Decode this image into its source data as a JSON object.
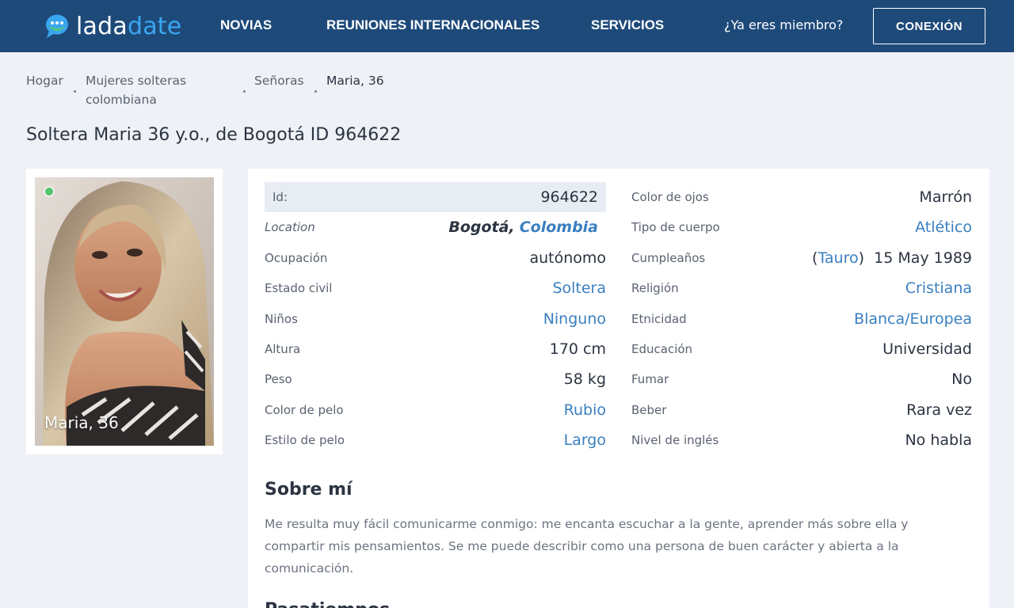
{
  "header": {
    "logo_part1": "lada",
    "logo_part2": "date",
    "nav": [
      "NOVIAS",
      "REUNIONES INTERNACIONALES",
      "SERVICIOS"
    ],
    "member_prompt": "¿Ya eres miembro?",
    "login_label": "CONEXIÓN"
  },
  "colors": {
    "header_bg": "#1e4a7a",
    "accent": "#3aa6f0",
    "link": "#3a7fbf",
    "online": "#4fc46b"
  },
  "breadcrumb": {
    "items": [
      "Hogar",
      "Mujeres solteras colombiana",
      "Señoras"
    ],
    "current": "Maria, 36"
  },
  "profile": {
    "title": "Soltera Maria 36 y.o., de Bogotá ID 964622",
    "photo_caption": "Maria, 36"
  },
  "details_left": [
    {
      "label": "Id:",
      "value": "964622"
    },
    {
      "label": "Location",
      "city": "Bogotá,",
      "country": "Colombia"
    },
    {
      "label": "Ocupación",
      "value": "autónomo"
    },
    {
      "label": "Estado civil",
      "value": "Soltera"
    },
    {
      "label": "Niños",
      "value": "Ninguno"
    },
    {
      "label": "Altura",
      "value": "170 cm"
    },
    {
      "label": "Peso",
      "value": "58 kg"
    },
    {
      "label": "Color de pelo",
      "value": "Rubio"
    },
    {
      "label": "Estilo de pelo",
      "value": "Largo"
    }
  ],
  "details_right": [
    {
      "label": "Color de ojos",
      "value": "Marrón"
    },
    {
      "label": "Tipo de cuerpo",
      "value": "Atlético"
    },
    {
      "label": "Cumpleaños",
      "zodiac": "Tauro",
      "date": "15 May 1989"
    },
    {
      "label": "Religión",
      "value": "Cristiana"
    },
    {
      "label": "Etnicidad",
      "value": "Blanca/Europea"
    },
    {
      "label": "Educación",
      "value": "Universidad"
    },
    {
      "label": "Fumar",
      "value": "No"
    },
    {
      "label": "Beber",
      "value": "Rara vez"
    },
    {
      "label": "Nivel de inglés",
      "value": "No habla"
    }
  ],
  "about": {
    "title": "Sobre mí",
    "text": "Me resulta muy fácil comunicarme conmigo: me encanta escuchar a la gente, aprender más sobre ella y compartir mis pensamientos. Se me puede describir como una persona de buen carácter y abierta a la comunicación."
  },
  "next_section_title": "Pasatiempos"
}
